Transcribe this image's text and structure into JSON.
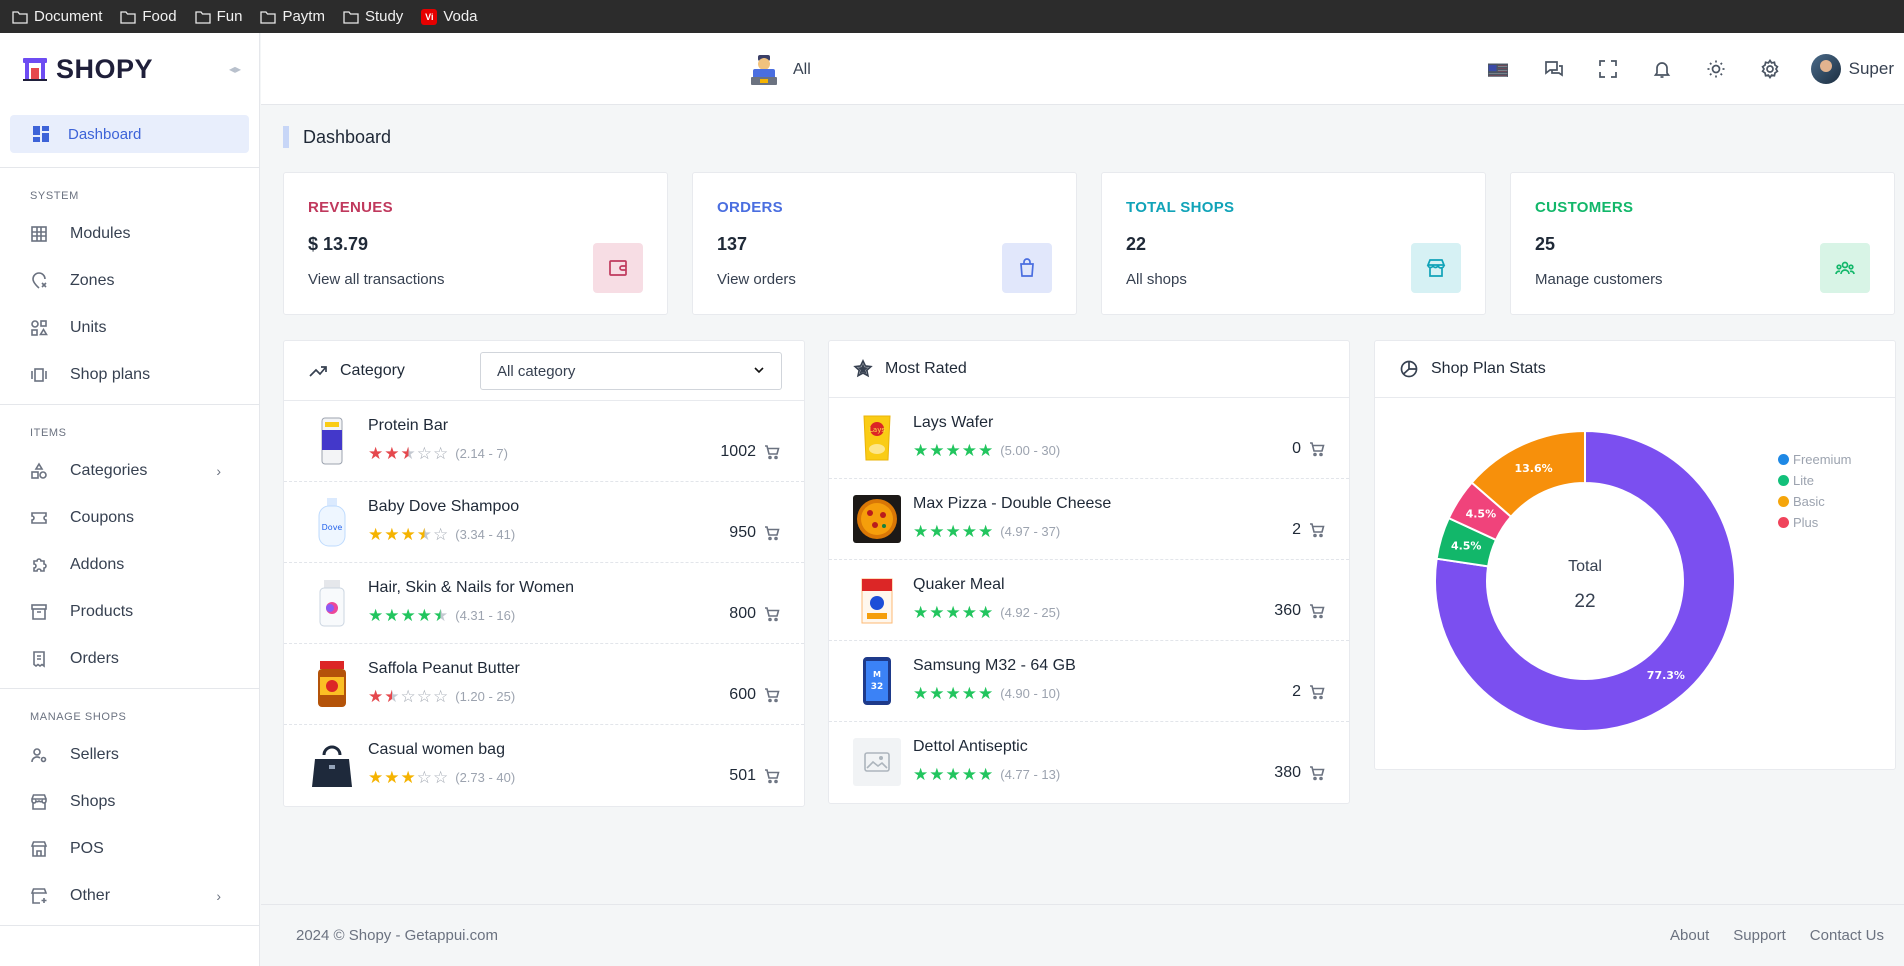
{
  "bookmarks": [
    {
      "label": "Document",
      "icon": "folder-icon"
    },
    {
      "label": "Food",
      "icon": "folder-icon"
    },
    {
      "label": "Fun",
      "icon": "folder-icon"
    },
    {
      "label": "Paytm",
      "icon": "folder-icon"
    },
    {
      "label": "Study",
      "icon": "folder-icon"
    },
    {
      "label": "Voda",
      "icon": "vodafone-icon"
    }
  ],
  "brand": {
    "name": "SHOPY"
  },
  "sidebar": {
    "active": {
      "label": "Dashboard",
      "icon": "dashboard-icon"
    },
    "sections": [
      {
        "title": "SYSTEM",
        "items": [
          {
            "label": "Modules",
            "icon": "grid-icon"
          },
          {
            "label": "Zones",
            "icon": "map-pin-icon"
          },
          {
            "label": "Units",
            "icon": "shapes-icon"
          },
          {
            "label": "Shop plans",
            "icon": "cards-icon"
          }
        ]
      },
      {
        "title": "ITEMS",
        "items": [
          {
            "label": "Categories",
            "icon": "category-icon",
            "chevron": true
          },
          {
            "label": "Coupons",
            "icon": "ticket-icon"
          },
          {
            "label": "Addons",
            "icon": "puzzle-icon"
          },
          {
            "label": "Products",
            "icon": "archive-icon"
          },
          {
            "label": "Orders",
            "icon": "receipt-icon"
          }
        ]
      },
      {
        "title": "MANAGE SHOPS",
        "items": [
          {
            "label": "Sellers",
            "icon": "user-settings-icon"
          },
          {
            "label": "Shops",
            "icon": "store-icon"
          },
          {
            "label": "POS",
            "icon": "building-store-icon"
          },
          {
            "label": "Other",
            "icon": "add-store-icon",
            "chevron": true
          }
        ]
      }
    ]
  },
  "header": {
    "store_label": "All",
    "user_name": "Super"
  },
  "page": {
    "title": "Dashboard"
  },
  "stats": [
    {
      "label": "REVENUES",
      "value": "$ 13.79",
      "link": "View all transactions",
      "color": "#c0395d",
      "bg": "#f7dde4",
      "icon": "wallet-icon"
    },
    {
      "label": "ORDERS",
      "value": "137",
      "link": "View orders",
      "color": "#4a6ee0",
      "bg": "#e1e7fb",
      "icon": "shopping-bag-icon"
    },
    {
      "label": "TOTAL SHOPS",
      "value": "22",
      "link": "All shops",
      "color": "#10a3b8",
      "bg": "#d6f1f4",
      "icon": "store-icon"
    },
    {
      "label": "CUSTOMERS",
      "value": "25",
      "link": "Manage customers",
      "color": "#12b76a",
      "bg": "#d8f4e6",
      "icon": "users-icon"
    }
  ],
  "category_panel": {
    "title": "Category",
    "select_value": "All category",
    "items": [
      {
        "name": "Protein Bar",
        "rating": 2.5,
        "meta": "(2.14 - 7)",
        "qty": "1002",
        "star_color": "#e5484d",
        "thumb": "protein-bar"
      },
      {
        "name": "Baby Dove Shampoo",
        "rating": 3.5,
        "meta": "(3.34 - 41)",
        "qty": "950",
        "star_color": "#f5b301",
        "thumb": "shampoo"
      },
      {
        "name": "Hair, Skin & Nails for Women",
        "rating": 4.5,
        "meta": "(4.31 - 16)",
        "qty": "800",
        "star_color": "#22c55e",
        "thumb": "vitamins"
      },
      {
        "name": "Saffola Peanut Butter",
        "rating": 1.5,
        "meta": "(1.20 - 25)",
        "qty": "600",
        "star_color": "#e5484d",
        "thumb": "peanut-butter"
      },
      {
        "name": "Casual women bag",
        "rating": 3,
        "meta": "(2.73 - 40)",
        "qty": "501",
        "star_color": "#f5b301",
        "thumb": "bag"
      }
    ]
  },
  "rated_panel": {
    "title": "Most Rated",
    "items": [
      {
        "name": "Lays Wafer",
        "rating": 5,
        "meta": "(5.00 - 30)",
        "qty": "0",
        "star_color": "#22c55e",
        "thumb": "chips"
      },
      {
        "name": "Max Pizza - Double Cheese",
        "rating": 5,
        "meta": "(4.97 - 37)",
        "qty": "2",
        "star_color": "#22c55e",
        "thumb": "pizza"
      },
      {
        "name": "Quaker Meal",
        "rating": 5,
        "meta": "(4.92 - 25)",
        "qty": "360",
        "star_color": "#22c55e",
        "thumb": "oats"
      },
      {
        "name": "Samsung M32 - 64 GB",
        "rating": 5,
        "meta": "(4.90 - 10)",
        "qty": "2",
        "star_color": "#22c55e",
        "thumb": "phone"
      },
      {
        "name": "Dettol Antiseptic",
        "rating": 5,
        "meta": "(4.77 - 13)",
        "qty": "380",
        "star_color": "#22c55e",
        "thumb": "placeholder"
      }
    ]
  },
  "chart_data": {
    "type": "pie",
    "title": "Shop Plan Stats",
    "center_label": "Total",
    "center_value": "22",
    "legend_position": "right",
    "series": [
      {
        "name": "Freemium",
        "value": 77.3,
        "label": "77.3%",
        "color": "#7b4ff0"
      },
      {
        "name": "Lite",
        "value": 4.5,
        "label": "4.5%",
        "color": "#12b76a"
      },
      {
        "name": "Plus",
        "value": 4.5,
        "label": "4.5%",
        "color": "#f0437b"
      },
      {
        "name": "Basic",
        "value": 13.6,
        "label": "13.6%",
        "color": "#f7900b"
      }
    ],
    "legend_order": [
      "Freemium",
      "Lite",
      "Basic",
      "Plus"
    ],
    "legend_colors": {
      "Freemium": "#1e88e5",
      "Lite": "#12c07a",
      "Basic": "#f5a50b",
      "Plus": "#f0435b"
    }
  },
  "footer": {
    "copyright": "2024 © Shopy - Getappui.com",
    "links": [
      "About",
      "Support",
      "Contact Us"
    ]
  }
}
